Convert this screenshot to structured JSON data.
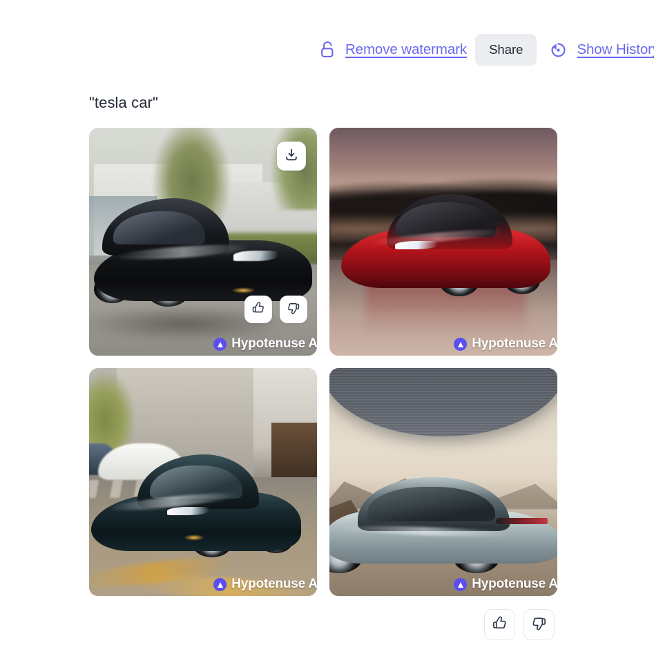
{
  "toolbar": {
    "remove_watermark": {
      "label": "Remove watermark",
      "icon": "unlock-icon",
      "color": "#6a68ee"
    },
    "share": {
      "label": "Share",
      "background": "#ebedf0",
      "text_color": "#1f2430"
    },
    "show_history": {
      "label": "Show History",
      "icon": "history-revert-icon",
      "color": "#6a68ee"
    }
  },
  "prompt": {
    "title": "\"tesla car\""
  },
  "results": {
    "columns": 2,
    "rows": 2,
    "items": [
      {
        "index": 1,
        "alt": "black Tesla Model S driving past a modern white house with trees",
        "watermark": "Hypotenuse AI",
        "watermark_truncated": "Hypotenuse AI",
        "overlay_visible": true,
        "download_icon": "download-icon",
        "thumbs_up_icon": "thumbs-up-icon",
        "thumbs_down_icon": "thumbs-down-icon"
      },
      {
        "index": 2,
        "alt": "red Tesla Model 3 at dusk on wet reflective ground with dark hills",
        "watermark": "Hypotenuse AI",
        "watermark_truncated": "Hypotenuse AI",
        "overlay_visible": false
      },
      {
        "index": 3,
        "alt": "dark teal Tesla Model S on a European city street with old buildings",
        "watermark": "Hypotenuse AI",
        "watermark_truncated": "Hypotenuse AI",
        "overlay_visible": false
      },
      {
        "index": 4,
        "alt": "silver Tesla Model 3 rear three-quarter view in a mountain landscape",
        "watermark": "Hypotenuse AI",
        "watermark_truncated": "Hypotenuse AI",
        "overlay_visible": false
      }
    ]
  },
  "feedback": {
    "thumbs_up_label": "thumbs-up",
    "thumbs_down_label": "thumbs-down",
    "thumbs_up_icon": "thumbs-up-icon",
    "thumbs_down_icon": "thumbs-down-icon"
  },
  "colors": {
    "accent_purple": "#6a68ee",
    "watermark_logo": "#5b4ef0",
    "share_bg": "#ebedf0",
    "text_dark": "#232a36",
    "page_bg": "#ffffff"
  }
}
